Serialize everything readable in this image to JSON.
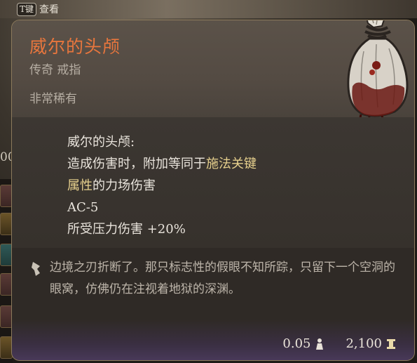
{
  "background": {
    "key_hint": "T键",
    "key_hint_label": "查看",
    "left_partial_number": "00"
  },
  "tooltip": {
    "name": "威尔的头颅",
    "type": "传奇 戒指",
    "rarity": "非常稀有",
    "description": {
      "title": "威尔的头颅:",
      "line1_prefix": "造成伤害时，附加等同于",
      "line1_highlight": "施法关键",
      "line2_highlight": "属性",
      "line2_suffix": "的力场伤害",
      "line3": "AC-5",
      "line4": "所受压力伤害 +20%"
    },
    "lore": "边境之刃折断了。那只标志性的假眼不知所踪，只留下一个空洞的眼窝，仿佛仍在注视着地狱的深渊。",
    "weight": "0.05",
    "value": "2,100",
    "colors": {
      "name": "#e8763d",
      "highlight": "#e6d08d",
      "text": "#e9e4dc",
      "border": "#8c7a5c"
    },
    "icons": {
      "weight": "weight-icon",
      "gold": "gold-coin-icon",
      "lore": "quill-icon"
    }
  }
}
